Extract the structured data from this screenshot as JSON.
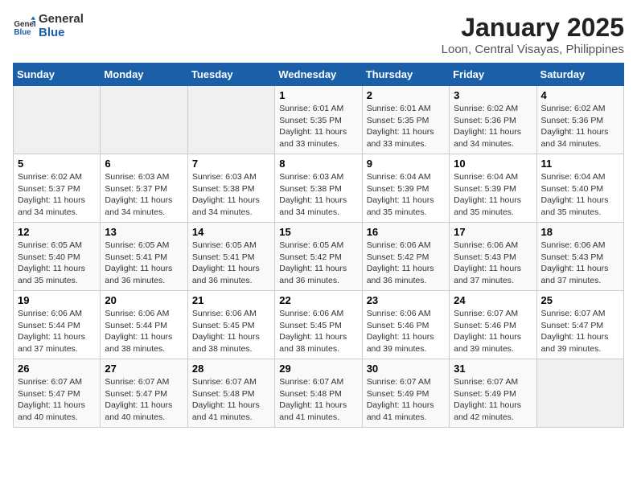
{
  "logo": {
    "text_general": "General",
    "text_blue": "Blue"
  },
  "header": {
    "month": "January 2025",
    "location": "Loon, Central Visayas, Philippines"
  },
  "weekdays": [
    "Sunday",
    "Monday",
    "Tuesday",
    "Wednesday",
    "Thursday",
    "Friday",
    "Saturday"
  ],
  "weeks": [
    [
      {
        "day": "",
        "sunrise": "",
        "sunset": "",
        "daylight": ""
      },
      {
        "day": "",
        "sunrise": "",
        "sunset": "",
        "daylight": ""
      },
      {
        "day": "",
        "sunrise": "",
        "sunset": "",
        "daylight": ""
      },
      {
        "day": "1",
        "sunrise": "Sunrise: 6:01 AM",
        "sunset": "Sunset: 5:35 PM",
        "daylight": "Daylight: 11 hours and 33 minutes."
      },
      {
        "day": "2",
        "sunrise": "Sunrise: 6:01 AM",
        "sunset": "Sunset: 5:35 PM",
        "daylight": "Daylight: 11 hours and 33 minutes."
      },
      {
        "day": "3",
        "sunrise": "Sunrise: 6:02 AM",
        "sunset": "Sunset: 5:36 PM",
        "daylight": "Daylight: 11 hours and 34 minutes."
      },
      {
        "day": "4",
        "sunrise": "Sunrise: 6:02 AM",
        "sunset": "Sunset: 5:36 PM",
        "daylight": "Daylight: 11 hours and 34 minutes."
      }
    ],
    [
      {
        "day": "5",
        "sunrise": "Sunrise: 6:02 AM",
        "sunset": "Sunset: 5:37 PM",
        "daylight": "Daylight: 11 hours and 34 minutes."
      },
      {
        "day": "6",
        "sunrise": "Sunrise: 6:03 AM",
        "sunset": "Sunset: 5:37 PM",
        "daylight": "Daylight: 11 hours and 34 minutes."
      },
      {
        "day": "7",
        "sunrise": "Sunrise: 6:03 AM",
        "sunset": "Sunset: 5:38 PM",
        "daylight": "Daylight: 11 hours and 34 minutes."
      },
      {
        "day": "8",
        "sunrise": "Sunrise: 6:03 AM",
        "sunset": "Sunset: 5:38 PM",
        "daylight": "Daylight: 11 hours and 34 minutes."
      },
      {
        "day": "9",
        "sunrise": "Sunrise: 6:04 AM",
        "sunset": "Sunset: 5:39 PM",
        "daylight": "Daylight: 11 hours and 35 minutes."
      },
      {
        "day": "10",
        "sunrise": "Sunrise: 6:04 AM",
        "sunset": "Sunset: 5:39 PM",
        "daylight": "Daylight: 11 hours and 35 minutes."
      },
      {
        "day": "11",
        "sunrise": "Sunrise: 6:04 AM",
        "sunset": "Sunset: 5:40 PM",
        "daylight": "Daylight: 11 hours and 35 minutes."
      }
    ],
    [
      {
        "day": "12",
        "sunrise": "Sunrise: 6:05 AM",
        "sunset": "Sunset: 5:40 PM",
        "daylight": "Daylight: 11 hours and 35 minutes."
      },
      {
        "day": "13",
        "sunrise": "Sunrise: 6:05 AM",
        "sunset": "Sunset: 5:41 PM",
        "daylight": "Daylight: 11 hours and 36 minutes."
      },
      {
        "day": "14",
        "sunrise": "Sunrise: 6:05 AM",
        "sunset": "Sunset: 5:41 PM",
        "daylight": "Daylight: 11 hours and 36 minutes."
      },
      {
        "day": "15",
        "sunrise": "Sunrise: 6:05 AM",
        "sunset": "Sunset: 5:42 PM",
        "daylight": "Daylight: 11 hours and 36 minutes."
      },
      {
        "day": "16",
        "sunrise": "Sunrise: 6:06 AM",
        "sunset": "Sunset: 5:42 PM",
        "daylight": "Daylight: 11 hours and 36 minutes."
      },
      {
        "day": "17",
        "sunrise": "Sunrise: 6:06 AM",
        "sunset": "Sunset: 5:43 PM",
        "daylight": "Daylight: 11 hours and 37 minutes."
      },
      {
        "day": "18",
        "sunrise": "Sunrise: 6:06 AM",
        "sunset": "Sunset: 5:43 PM",
        "daylight": "Daylight: 11 hours and 37 minutes."
      }
    ],
    [
      {
        "day": "19",
        "sunrise": "Sunrise: 6:06 AM",
        "sunset": "Sunset: 5:44 PM",
        "daylight": "Daylight: 11 hours and 37 minutes."
      },
      {
        "day": "20",
        "sunrise": "Sunrise: 6:06 AM",
        "sunset": "Sunset: 5:44 PM",
        "daylight": "Daylight: 11 hours and 38 minutes."
      },
      {
        "day": "21",
        "sunrise": "Sunrise: 6:06 AM",
        "sunset": "Sunset: 5:45 PM",
        "daylight": "Daylight: 11 hours and 38 minutes."
      },
      {
        "day": "22",
        "sunrise": "Sunrise: 6:06 AM",
        "sunset": "Sunset: 5:45 PM",
        "daylight": "Daylight: 11 hours and 38 minutes."
      },
      {
        "day": "23",
        "sunrise": "Sunrise: 6:06 AM",
        "sunset": "Sunset: 5:46 PM",
        "daylight": "Daylight: 11 hours and 39 minutes."
      },
      {
        "day": "24",
        "sunrise": "Sunrise: 6:07 AM",
        "sunset": "Sunset: 5:46 PM",
        "daylight": "Daylight: 11 hours and 39 minutes."
      },
      {
        "day": "25",
        "sunrise": "Sunrise: 6:07 AM",
        "sunset": "Sunset: 5:47 PM",
        "daylight": "Daylight: 11 hours and 39 minutes."
      }
    ],
    [
      {
        "day": "26",
        "sunrise": "Sunrise: 6:07 AM",
        "sunset": "Sunset: 5:47 PM",
        "daylight": "Daylight: 11 hours and 40 minutes."
      },
      {
        "day": "27",
        "sunrise": "Sunrise: 6:07 AM",
        "sunset": "Sunset: 5:47 PM",
        "daylight": "Daylight: 11 hours and 40 minutes."
      },
      {
        "day": "28",
        "sunrise": "Sunrise: 6:07 AM",
        "sunset": "Sunset: 5:48 PM",
        "daylight": "Daylight: 11 hours and 41 minutes."
      },
      {
        "day": "29",
        "sunrise": "Sunrise: 6:07 AM",
        "sunset": "Sunset: 5:48 PM",
        "daylight": "Daylight: 11 hours and 41 minutes."
      },
      {
        "day": "30",
        "sunrise": "Sunrise: 6:07 AM",
        "sunset": "Sunset: 5:49 PM",
        "daylight": "Daylight: 11 hours and 41 minutes."
      },
      {
        "day": "31",
        "sunrise": "Sunrise: 6:07 AM",
        "sunset": "Sunset: 5:49 PM",
        "daylight": "Daylight: 11 hours and 42 minutes."
      },
      {
        "day": "",
        "sunrise": "",
        "sunset": "",
        "daylight": ""
      }
    ]
  ]
}
